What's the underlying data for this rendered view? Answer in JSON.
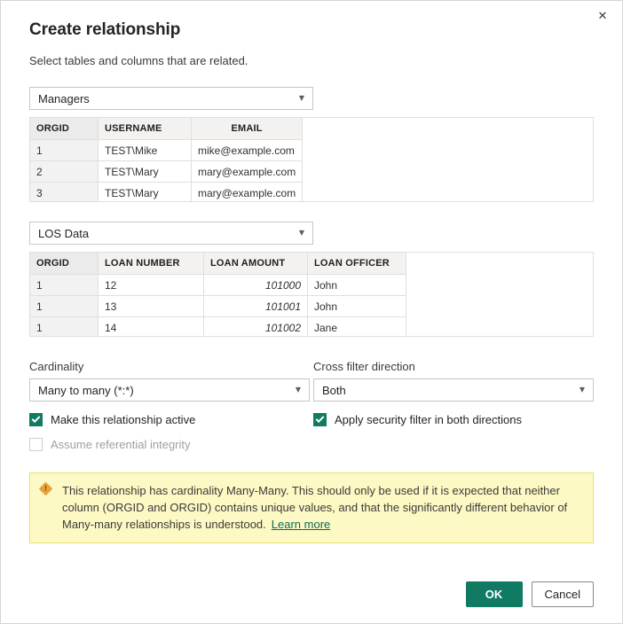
{
  "dialog": {
    "title": "Create relationship",
    "subtitle": "Select tables and columns that are related.",
    "close_icon": "close-icon"
  },
  "table1": {
    "selected": "Managers",
    "columns": [
      "ORGID",
      "USERNAME",
      "EMAIL"
    ],
    "rows": [
      [
        "1",
        "TEST\\Mike",
        "mike@example.com"
      ],
      [
        "2",
        "TEST\\Mary",
        "mary@example.com"
      ],
      [
        "3",
        "TEST\\Mary",
        "mary@example.com"
      ]
    ],
    "selected_column": "ORGID"
  },
  "table2": {
    "selected": "LOS Data",
    "columns": [
      "ORGID",
      "LOAN NUMBER",
      "LOAN AMOUNT",
      "LOAN OFFICER"
    ],
    "rows": [
      [
        "1",
        "12",
        "101000",
        "John"
      ],
      [
        "1",
        "13",
        "101001",
        "John"
      ],
      [
        "1",
        "14",
        "101002",
        "Jane"
      ]
    ],
    "selected_column": "ORGID"
  },
  "options": {
    "cardinality_label": "Cardinality",
    "cardinality_value": "Many to many (*:*)",
    "cross_filter_label": "Cross filter direction",
    "cross_filter_value": "Both",
    "active_checkbox_label": "Make this relationship active",
    "active_checkbox_checked": true,
    "referential_checkbox_label": "Assume referential integrity",
    "referential_checkbox_checked": false,
    "security_checkbox_label": "Apply security filter in both directions",
    "security_checkbox_checked": true
  },
  "warning": {
    "icon": "warning-icon",
    "text": "This relationship has cardinality Many-Many. This should only be used if it is expected that neither column (ORGID and ORGID) contains unique values, and that the significantly different behavior of Many-many relationships is understood.",
    "link": "Learn more"
  },
  "footer": {
    "ok_label": "OK",
    "cancel_label": "Cancel"
  },
  "colors": {
    "accent": "#107a62",
    "warning_bg": "#fdf9c4",
    "warning_border": "#e8e06e",
    "warning_icon": "#e8a33d",
    "link": "#0b6a59"
  }
}
